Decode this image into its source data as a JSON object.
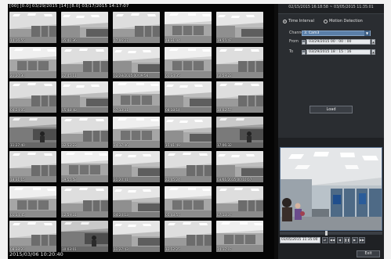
{
  "thumbnails": {
    "header_text": "[00] [0.0] 03/29/2015 [14] [8.0] 03/17/2015 14:17:07",
    "footer_text": "2015/03/06 10:20:40",
    "items": [
      {
        "time": "14:16:55",
        "variant": "a"
      },
      {
        "time": "15:41:36",
        "variant": "b"
      },
      {
        "time": "17:06:27",
        "variant": "a"
      },
      {
        "time": "18:31:04",
        "variant": "c"
      },
      {
        "time": "19:55:47",
        "variant": "b"
      },
      {
        "time": "21:20:30",
        "variant": "c"
      },
      {
        "time": "22:45:11",
        "variant": "a"
      },
      {
        "time": "02/28/2015 00:09:56",
        "variant": "b"
      },
      {
        "time": "01:34:35",
        "variant": "c"
      },
      {
        "time": "02:59:22",
        "variant": "a"
      },
      {
        "time": "04:24:05",
        "variant": "a"
      },
      {
        "time": "05:48:48",
        "variant": "b"
      },
      {
        "time": "07:13:31",
        "variant": "c"
      },
      {
        "time": "08:38:14",
        "variant": "b"
      },
      {
        "time": "10:02:57",
        "variant": "a"
      },
      {
        "time": "11:27:40",
        "variant": "d"
      },
      {
        "time": "12:52:23",
        "variant": "a"
      },
      {
        "time": "14:17:06",
        "variant": "c"
      },
      {
        "time": "15:41:49",
        "variant": "b"
      },
      {
        "time": "17:06:32",
        "variant": "d"
      },
      {
        "time": "18:31:15",
        "variant": "a"
      },
      {
        "time": "19:55:58",
        "variant": "c"
      },
      {
        "time": "21:20:41",
        "variant": "b"
      },
      {
        "time": "22:45:24",
        "variant": "a"
      },
      {
        "time": "03/01/2015 00:10:07",
        "variant": "b"
      },
      {
        "time": "01:34:45",
        "variant": "c"
      },
      {
        "time": "02:59:31",
        "variant": "a"
      },
      {
        "time": "04:24:13",
        "variant": "b"
      },
      {
        "time": "05:48:57",
        "variant": "c"
      },
      {
        "time": "07:13:37",
        "variant": "a"
      },
      {
        "time": "08:38:20",
        "variant": "a"
      },
      {
        "time": "10:03:01",
        "variant": "d"
      },
      {
        "time": "11:27:43",
        "variant": "b"
      },
      {
        "time": "12:52:25",
        "variant": "a"
      },
      {
        "time": "14:17:07",
        "variant": "c"
      }
    ]
  },
  "search": {
    "range_text": "02/15/2015 16:18:58 ~ 03/05/2015 11:35:01",
    "mode_time": "Time Interval",
    "mode_motion": "Motion Detection",
    "channel_label": "Channel",
    "channel_value": "3. Cam3",
    "from_label": "From",
    "from_value": "03/29/2015 00 : 00 : 00",
    "to_label": "To",
    "to_value": "03/29/2015 18 : 15 : 16",
    "load_label": "Load"
  },
  "playback": {
    "time_value": "03/05/2015 11:35:00",
    "progress": 0.45,
    "exit_label": "Exit"
  },
  "icons": {
    "calendar": "calendar-icon",
    "spin": "spin-up-icon",
    "rewind": "rewind-icon",
    "step_back": "step-back-icon",
    "pause": "pause-icon",
    "play": "play-icon",
    "fast_forward": "fast-forward-icon",
    "sync": "sync-icon"
  },
  "colors": {
    "accent": "#5a7fa8",
    "panel": "#2a2d31",
    "background": "#0d0d0d"
  }
}
